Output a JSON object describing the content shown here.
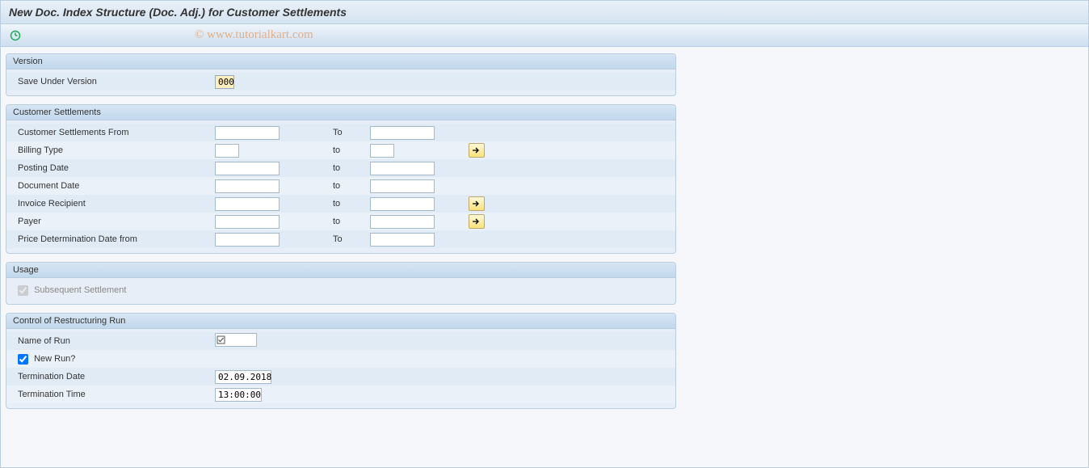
{
  "title": "New Doc. Index Structure (Doc. Adj.) for Customer Settlements",
  "watermark": "© www.tutorialkart.com",
  "version_group": {
    "header": "Version",
    "save_under_version_label": "Save Under Version",
    "save_under_version_value": "000"
  },
  "cs_group": {
    "header": "Customer Settlements",
    "rows": {
      "cs_from_label": "Customer Settlements From",
      "cs_to_label": "To",
      "billing_type_label": "Billing Type",
      "billing_type_to": "to",
      "posting_date_label": "Posting Date",
      "posting_date_to": "to",
      "doc_date_label": "Document Date",
      "doc_date_to": "to",
      "inv_recip_label": "Invoice Recipient",
      "inv_recip_to": "to",
      "payer_label": "Payer",
      "payer_to": "to",
      "price_det_label": "Price Determination Date from",
      "price_det_to": "To"
    }
  },
  "usage_group": {
    "header": "Usage",
    "subsequent_label": "Subsequent Settlement"
  },
  "control_group": {
    "header": "Control of Restructuring Run",
    "name_of_run_label": "Name of Run",
    "new_run_label": "New Run?",
    "term_date_label": "Termination Date",
    "term_date_value": "02.09.2018",
    "term_time_label": "Termination Time",
    "term_time_value": "13:00:00"
  }
}
